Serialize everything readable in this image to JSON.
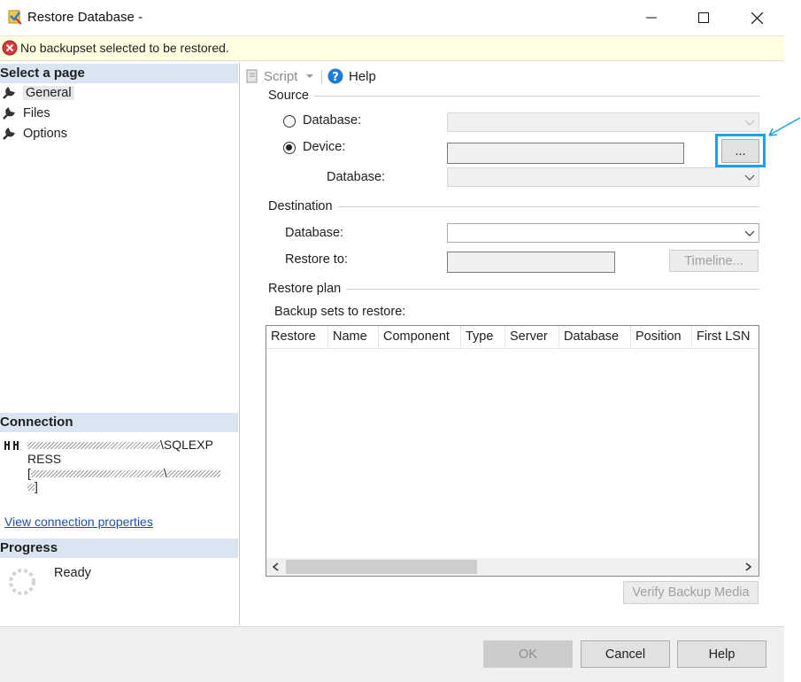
{
  "window": {
    "title": "Restore Database -"
  },
  "message": "No backupset selected to be restored.",
  "left": {
    "select_page_header": "Select a page",
    "pages": [
      "General",
      "Files",
      "Options"
    ],
    "connection_header": "Connection",
    "connection_line1": "\\SQLEXP",
    "connection_line2": "RESS",
    "connection_line3a": "[",
    "connection_line3b": "\\",
    "connection_line4": "]",
    "view_connection_link": "View connection properties",
    "progress_header": "Progress",
    "progress_status": "Ready"
  },
  "toolbar": {
    "script_label": "Script",
    "help_label": "Help"
  },
  "source": {
    "group_label": "Source",
    "database_radio": "Database:",
    "device_radio": "Device:",
    "browse_button": "...",
    "database_label": "Database:"
  },
  "destination": {
    "group_label": "Destination",
    "database_label": "Database:",
    "restore_to_label": "Restore to:",
    "timeline_button": "Timeline..."
  },
  "restore_plan": {
    "group_label": "Restore plan",
    "backup_sets_label": "Backup sets to restore:",
    "columns": [
      "Restore",
      "Name",
      "Component",
      "Type",
      "Server",
      "Database",
      "Position",
      "First LSN"
    ],
    "verify_button": "Verify Backup Media"
  },
  "buttons": {
    "ok": "OK",
    "cancel": "Cancel",
    "help": "Help"
  },
  "colors": {
    "highlight": "#1ea0e6",
    "section_header": "#dbe5f1",
    "message_bg": "#ffffe1"
  }
}
